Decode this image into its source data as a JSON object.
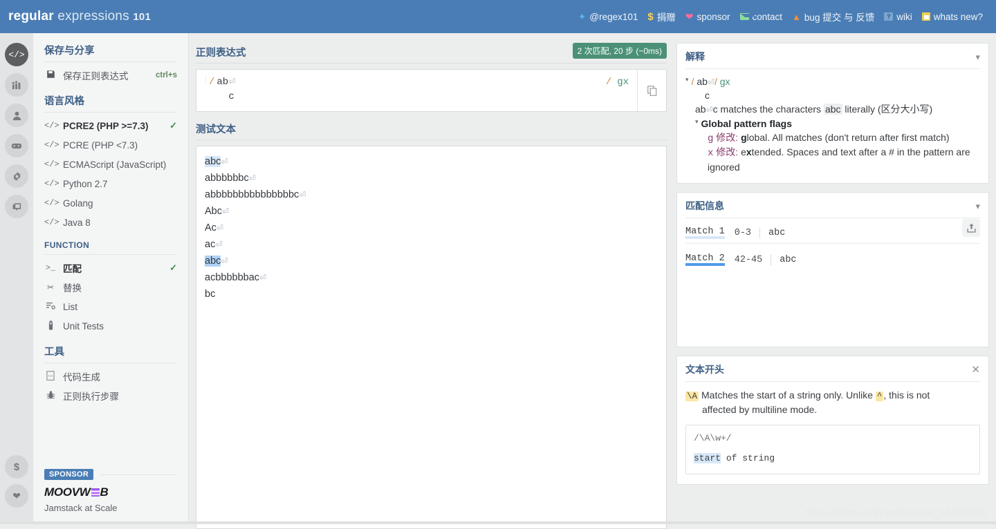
{
  "brand": {
    "part1": "regular",
    "part2": "expressions",
    "part3": "101"
  },
  "nav": [
    {
      "label": "@regex101",
      "icon": "twitter-icon"
    },
    {
      "label": "捐赠",
      "icon": "dollar-icon"
    },
    {
      "label": "sponsor",
      "icon": "heart-icon"
    },
    {
      "label": "contact",
      "icon": "mail-icon"
    },
    {
      "label": "bug 提交 与 反馈",
      "icon": "warning-icon"
    },
    {
      "label": "wiki",
      "icon": "wiki-icon"
    },
    {
      "label": "whats new?",
      "icon": "news-icon"
    }
  ],
  "rail": {
    "top": [
      "code-icon",
      "library-icon",
      "account-icon",
      "gamepad-icon",
      "gear-icon",
      "chat-icon"
    ],
    "bottom": [
      "dollar-icon",
      "heart-icon"
    ]
  },
  "sidebar": {
    "save_section": {
      "title": "保存与分享",
      "item_label": "保存正则表达式",
      "shortcut": "ctrl+s"
    },
    "flavor_section": {
      "title": "语言风格",
      "items": [
        {
          "label": "PCRE2 (PHP >=7.3)",
          "selected": true
        },
        {
          "label": "PCRE (PHP <7.3)",
          "selected": false
        },
        {
          "label": "ECMAScript (JavaScript)",
          "selected": false
        },
        {
          "label": "Python 2.7",
          "selected": false
        },
        {
          "label": "Golang",
          "selected": false
        },
        {
          "label": "Java 8",
          "selected": false
        }
      ]
    },
    "function_section": {
      "title": "FUNCTION",
      "items": [
        {
          "label": "匹配",
          "icon": "prompt-icon",
          "selected": true
        },
        {
          "label": "替换",
          "icon": "scissors-icon",
          "selected": false
        },
        {
          "label": "List",
          "icon": "list-icon",
          "selected": false
        },
        {
          "label": "Unit Tests",
          "icon": "flask-icon",
          "selected": false
        }
      ]
    },
    "tools_section": {
      "title": "工具",
      "items": [
        {
          "label": "代码生成",
          "icon": "code-file-icon"
        },
        {
          "label": "正则执行步骤",
          "icon": "bug-icon"
        }
      ]
    },
    "sponsor": {
      "tag": "SPONSOR",
      "name": "MOOVW",
      "name_tail": "B",
      "tagline": "Jamstack at Scale"
    }
  },
  "regex_panel": {
    "title": "正则表达式",
    "badge": "2 次匹配, 20 步 (~0ms)",
    "slash": "/",
    "line1": "ab",
    "crlf": "⏎",
    "line2": "c",
    "flag_slash": "/",
    "flags": "gx",
    "copy_icon": "copy-icon"
  },
  "test_panel": {
    "title": "测试文本",
    "lines": [
      {
        "text": "abc",
        "crlf": "⏎",
        "highlight": "light"
      },
      {
        "text": "abbbbbbc",
        "crlf": "⏎",
        "highlight": "none"
      },
      {
        "text": "abbbbbbbbbbbbbbbc",
        "crlf": "⏎",
        "highlight": "none"
      },
      {
        "text": "Abc",
        "crlf": "⏎",
        "highlight": "none"
      },
      {
        "text": "Ac",
        "crlf": "⏎",
        "highlight": "none"
      },
      {
        "text": "ac",
        "crlf": "⏎",
        "highlight": "none"
      },
      {
        "text": "abc",
        "crlf": "⏎",
        "highlight": "strong"
      },
      {
        "text": "acbbbbbbac",
        "crlf": "⏎",
        "highlight": "none"
      },
      {
        "text": "bc",
        "crlf": "",
        "highlight": "none"
      }
    ]
  },
  "explanation": {
    "title": "解释",
    "pattern_slash1": "/",
    "pattern_body": "ab",
    "pattern_crlf": "⏎",
    "pattern_slash2": "/",
    "pattern_flags": "gx",
    "pattern_line2": "c",
    "desc_pre": "ab",
    "desc_crlf": "⏎",
    "desc_mid": "c matches the characters",
    "desc_chip": "abc",
    "desc_post": "literally (区分大小写)",
    "flags_header": "Global pattern flags",
    "flag_items": [
      {
        "letter": "g",
        "zh": "修改",
        "bold": "g",
        "rest": "lobal. All matches (don't return after first match)"
      },
      {
        "letter": "x",
        "zh": "修改",
        "pre": "e",
        "bold": "x",
        "rest": "tended. Spaces and text after a # in the pattern are ignored"
      }
    ]
  },
  "match_info": {
    "title": "匹配信息",
    "share_icon": "share-icon",
    "matches": [
      {
        "label": "Match 1",
        "range": "0-3",
        "value": "abc"
      },
      {
        "label": "Match 2",
        "range": "42-45",
        "value": "abc"
      }
    ]
  },
  "quickref": {
    "title": "文本开头",
    "token": "\\A",
    "desc_a": "Matches the start of a string only. Unlike",
    "token2": "^",
    "desc_b": ", this is not",
    "desc_c": "affected by multiline mode.",
    "example_pattern": "/\\A\\w+/",
    "example_hl": "start",
    "example_rest": " of string"
  },
  "watermark": "https://blog.csdn.net/weixin_54646993",
  "colors": {
    "topbar": "#4a7db5",
    "accent": "#3e5f85",
    "badge_green": "#4a9177",
    "highlight_light": "#d6e7f8",
    "highlight_strong": "#aed2f5",
    "token_yellow": "#fbe6a2"
  }
}
